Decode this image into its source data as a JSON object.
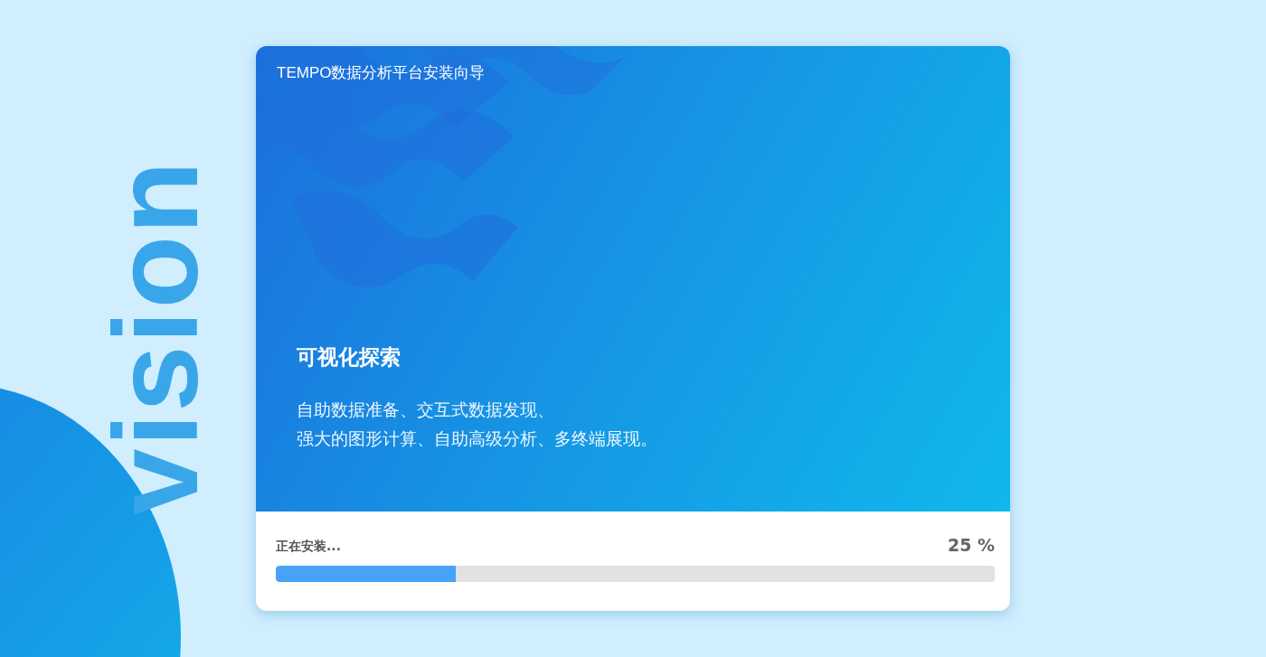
{
  "side_text": "vision",
  "window": {
    "title": "TEMPO数据分析平台安装向导"
  },
  "banner": {
    "heading": "可视化探索",
    "description_lines": [
      "自助数据准备、交互式数据发现、",
      "强大的图形计算、自助高级分析、多终端展现。"
    ]
  },
  "progress": {
    "label": "正在安装...",
    "reading": "25 %",
    "level": 0.25
  }
}
